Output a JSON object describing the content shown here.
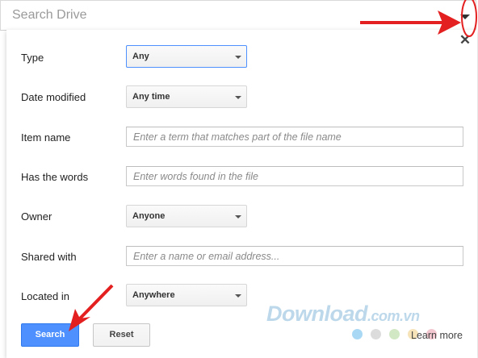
{
  "search_bar": {
    "placeholder": "Search Drive"
  },
  "panel": {
    "fields": [
      {
        "label": "Type",
        "kind": "dropdown",
        "value": "Any"
      },
      {
        "label": "Date modified",
        "kind": "dropdown",
        "value": "Any time"
      },
      {
        "label": "Item name",
        "kind": "text",
        "placeholder": "Enter a term that matches part of the file name"
      },
      {
        "label": "Has the words",
        "kind": "text",
        "placeholder": "Enter words found in the file"
      },
      {
        "label": "Owner",
        "kind": "dropdown",
        "value": "Anyone"
      },
      {
        "label": "Shared with",
        "kind": "text",
        "placeholder": "Enter a name or email address..."
      },
      {
        "label": "Located in",
        "kind": "dropdown",
        "value": "Anywhere"
      }
    ],
    "buttons": {
      "search": "Search",
      "reset": "Reset"
    },
    "learn_more": "Learn more",
    "close_icon": "close-icon"
  },
  "watermark": {
    "main": "Download",
    "suffix": ".com.vn"
  },
  "colors": {
    "primary_button": "#4d90fe",
    "annotation_arrow": "#e41f1f",
    "dot_colors": [
      "#a9d8f5",
      "#dcdcdc",
      "#d2e8c4",
      "#f6e3b8",
      "#f3c7cf"
    ]
  }
}
